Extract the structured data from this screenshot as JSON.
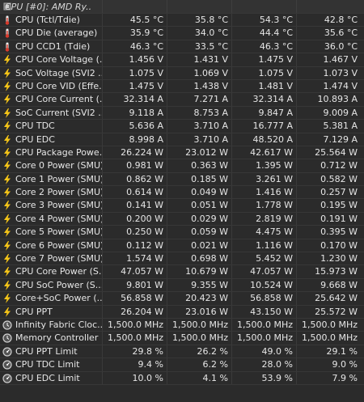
{
  "header": {
    "label": "CPU [#0]: AMD Ry...",
    "icon": "cpu-chip-icon"
  },
  "rows": [
    {
      "icon": "thermometer",
      "label": "CPU (Tctl/Tdie)",
      "v": [
        "45.5 °C",
        "35.8 °C",
        "54.3 °C",
        "42.8 °C"
      ]
    },
    {
      "icon": "thermometer",
      "label": "CPU Die (average)",
      "v": [
        "35.9 °C",
        "34.0 °C",
        "44.4 °C",
        "35.6 °C"
      ]
    },
    {
      "icon": "thermometer",
      "label": "CPU CCD1 (Tdie)",
      "v": [
        "46.3 °C",
        "33.5 °C",
        "46.3 °C",
        "36.0 °C"
      ]
    },
    {
      "icon": "bolt",
      "label": "CPU Core Voltage (...",
      "v": [
        "1.456 V",
        "1.431 V",
        "1.475 V",
        "1.467 V"
      ]
    },
    {
      "icon": "bolt",
      "label": "SoC Voltage (SVI2 ...",
      "v": [
        "1.075 V",
        "1.069 V",
        "1.075 V",
        "1.073 V"
      ]
    },
    {
      "icon": "bolt",
      "label": "CPU Core VID (Effe...",
      "v": [
        "1.475 V",
        "1.438 V",
        "1.481 V",
        "1.474 V"
      ]
    },
    {
      "icon": "bolt",
      "label": "CPU Core Current (...",
      "v": [
        "32.314 A",
        "7.271 A",
        "32.314 A",
        "10.893 A"
      ]
    },
    {
      "icon": "bolt",
      "label": "SoC Current (SVI2 ...",
      "v": [
        "9.118 A",
        "8.753 A",
        "9.847 A",
        "9.009 A"
      ]
    },
    {
      "icon": "bolt",
      "label": "CPU TDC",
      "v": [
        "5.636 A",
        "3.710 A",
        "16.777 A",
        "5.381 A"
      ]
    },
    {
      "icon": "bolt",
      "label": "CPU EDC",
      "v": [
        "8.998 A",
        "3.710 A",
        "48.520 A",
        "7.129 A"
      ]
    },
    {
      "icon": "bolt",
      "label": "CPU Package Powe...",
      "v": [
        "26.224 W",
        "23.012 W",
        "42.617 W",
        "25.564 W"
      ]
    },
    {
      "icon": "bolt",
      "label": "Core 0 Power (SMU)",
      "v": [
        "0.981 W",
        "0.363 W",
        "1.395 W",
        "0.712 W"
      ]
    },
    {
      "icon": "bolt",
      "label": "Core 1 Power (SMU)",
      "v": [
        "0.862 W",
        "0.185 W",
        "3.261 W",
        "0.582 W"
      ]
    },
    {
      "icon": "bolt",
      "label": "Core 2 Power (SMU)",
      "v": [
        "0.614 W",
        "0.049 W",
        "1.416 W",
        "0.257 W"
      ]
    },
    {
      "icon": "bolt",
      "label": "Core 3 Power (SMU)",
      "v": [
        "0.141 W",
        "0.051 W",
        "1.778 W",
        "0.195 W"
      ]
    },
    {
      "icon": "bolt",
      "label": "Core 4 Power (SMU)",
      "v": [
        "0.200 W",
        "0.029 W",
        "2.819 W",
        "0.191 W"
      ]
    },
    {
      "icon": "bolt",
      "label": "Core 5 Power (SMU)",
      "v": [
        "0.250 W",
        "0.059 W",
        "4.475 W",
        "0.395 W"
      ]
    },
    {
      "icon": "bolt",
      "label": "Core 6 Power (SMU)",
      "v": [
        "0.112 W",
        "0.021 W",
        "1.116 W",
        "0.170 W"
      ]
    },
    {
      "icon": "bolt",
      "label": "Core 7 Power (SMU)",
      "v": [
        "1.574 W",
        "0.698 W",
        "5.452 W",
        "1.230 W"
      ]
    },
    {
      "icon": "bolt",
      "label": "CPU Core Power (S...",
      "v": [
        "47.057 W",
        "10.679 W",
        "47.057 W",
        "15.973 W"
      ]
    },
    {
      "icon": "bolt",
      "label": "CPU SoC Power (S...",
      "v": [
        "9.801 W",
        "9.355 W",
        "10.524 W",
        "9.668 W"
      ]
    },
    {
      "icon": "bolt",
      "label": "Core+SoC Power (...",
      "v": [
        "56.858 W",
        "20.423 W",
        "56.858 W",
        "25.642 W"
      ]
    },
    {
      "icon": "bolt",
      "label": "CPU PPT",
      "v": [
        "26.204 W",
        "23.016 W",
        "43.150 W",
        "25.572 W"
      ]
    },
    {
      "icon": "clock",
      "label": "Infinity Fabric Cloc...",
      "v": [
        "1,500.0 MHz",
        "1,500.0 MHz",
        "1,500.0 MHz",
        "1,500.0 MHz"
      ]
    },
    {
      "icon": "clock",
      "label": "Memory Controller ...",
      "v": [
        "1,500.0 MHz",
        "1,500.0 MHz",
        "1,500.0 MHz",
        "1,500.0 MHz"
      ]
    },
    {
      "icon": "gauge",
      "label": "CPU PPT Limit",
      "v": [
        "29.8 %",
        "26.2 %",
        "49.0 %",
        "29.1 %"
      ]
    },
    {
      "icon": "gauge",
      "label": "CPU TDC Limit",
      "v": [
        "9.4 %",
        "6.2 %",
        "28.0 %",
        "9.0 %"
      ]
    },
    {
      "icon": "gauge",
      "label": "CPU EDC Limit",
      "v": [
        "10.0 %",
        "4.1 %",
        "53.9 %",
        "7.9 %"
      ]
    }
  ],
  "colors": {
    "bolt": "#f5c518",
    "thermometer": "#d83a2c",
    "clock": "#d0d0d0",
    "gauge": "#d0d0d0"
  }
}
